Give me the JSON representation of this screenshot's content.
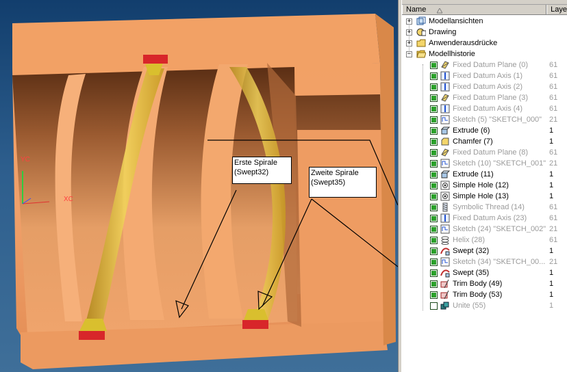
{
  "viewport": {
    "labels": {
      "axis_y": "YC",
      "axis_x": "XC"
    },
    "callouts": [
      {
        "id": "callout-erste",
        "text": "Erste Spirale\n(Swept32)"
      },
      {
        "id": "callout-zweite",
        "text": "Zweite Spirale\n(Swept35)"
      }
    ]
  },
  "navigator": {
    "columns": {
      "name": "Name",
      "layer": "Laye"
    },
    "top_nodes": [
      {
        "label": "Modellansichten",
        "expander": "+",
        "icon": "model-views-icon"
      },
      {
        "label": "Drawing",
        "expander": "+",
        "icon": "drawing-icon"
      },
      {
        "label": "Anwenderausdrücke",
        "expander": "+",
        "icon": "folder-icon"
      },
      {
        "label": "Modellhistorie",
        "expander": "−",
        "icon": "open-folder-icon"
      }
    ],
    "history": [
      {
        "label": "Fixed Datum Plane (0)",
        "layer": "61",
        "state": "grey",
        "checked": true,
        "icon": "datum-plane-icon"
      },
      {
        "label": "Fixed Datum Axis (1)",
        "layer": "61",
        "state": "grey",
        "checked": true,
        "icon": "datum-axis-icon"
      },
      {
        "label": "Fixed Datum Axis (2)",
        "layer": "61",
        "state": "grey",
        "checked": true,
        "icon": "datum-axis-icon"
      },
      {
        "label": "Fixed Datum Plane (3)",
        "layer": "61",
        "state": "grey",
        "checked": true,
        "icon": "datum-plane-icon"
      },
      {
        "label": "Fixed Datum Axis (4)",
        "layer": "61",
        "state": "grey",
        "checked": true,
        "icon": "datum-axis-icon"
      },
      {
        "label": "Sketch (5) \"SKETCH_000\"",
        "layer": "21",
        "state": "grey",
        "checked": true,
        "icon": "sketch-icon"
      },
      {
        "label": "Extrude (6)",
        "layer": "1",
        "state": "black",
        "checked": true,
        "icon": "extrude-icon"
      },
      {
        "label": "Chamfer (7)",
        "layer": "1",
        "state": "black",
        "checked": true,
        "icon": "chamfer-icon"
      },
      {
        "label": "Fixed Datum Plane (8)",
        "layer": "61",
        "state": "grey",
        "checked": true,
        "icon": "datum-plane-icon"
      },
      {
        "label": "Sketch (10) \"SKETCH_001\"",
        "layer": "21",
        "state": "grey",
        "checked": true,
        "icon": "sketch-icon"
      },
      {
        "label": "Extrude (11)",
        "layer": "1",
        "state": "black",
        "checked": true,
        "icon": "extrude-icon"
      },
      {
        "label": "Simple Hole (12)",
        "layer": "1",
        "state": "black",
        "checked": true,
        "icon": "hole-icon"
      },
      {
        "label": "Simple Hole (13)",
        "layer": "1",
        "state": "black",
        "checked": true,
        "icon": "hole-icon"
      },
      {
        "label": "Symbolic Thread (14)",
        "layer": "61",
        "state": "grey",
        "checked": true,
        "icon": "thread-icon"
      },
      {
        "label": "Fixed Datum Axis (23)",
        "layer": "61",
        "state": "grey",
        "checked": true,
        "icon": "datum-axis-icon"
      },
      {
        "label": "Sketch (24) \"SKETCH_002\"",
        "layer": "21",
        "state": "grey",
        "checked": true,
        "icon": "sketch-icon"
      },
      {
        "label": "Helix (28)",
        "layer": "61",
        "state": "grey",
        "checked": true,
        "icon": "helix-icon"
      },
      {
        "label": "Swept (32)",
        "layer": "1",
        "state": "black",
        "checked": true,
        "icon": "swept-icon"
      },
      {
        "label": "Sketch (34) \"SKETCH_00...",
        "layer": "21",
        "state": "grey",
        "checked": true,
        "icon": "sketch-icon"
      },
      {
        "label": "Swept (35)",
        "layer": "1",
        "state": "black",
        "checked": true,
        "icon": "swept-icon"
      },
      {
        "label": "Trim Body (49)",
        "layer": "1",
        "state": "black",
        "checked": true,
        "icon": "trim-body-icon"
      },
      {
        "label": "Trim Body (53)",
        "layer": "1",
        "state": "black",
        "checked": true,
        "icon": "trim-body-icon"
      },
      {
        "label": "Unite (55)",
        "layer": "1",
        "state": "grey",
        "checked": false,
        "icon": "unite-icon"
      }
    ]
  },
  "colors": {
    "body_orange": "#e8965a",
    "groove_dark": "#6b3a1c",
    "swept_yellow": "#d8b82e",
    "swept_red": "#d8262a",
    "background_blue": "#2d5e8d"
  }
}
